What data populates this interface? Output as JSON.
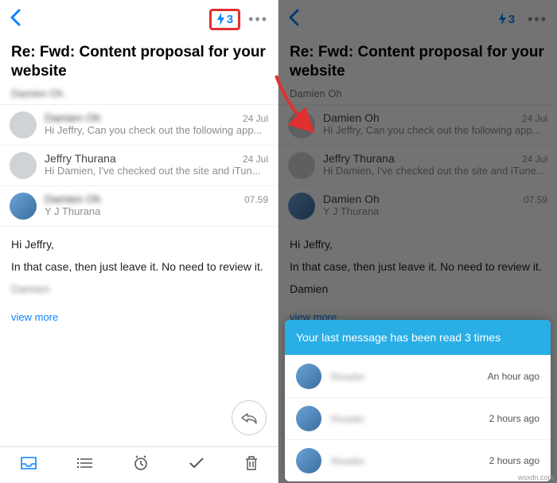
{
  "left": {
    "bolt_count": "3",
    "subject": "Re: Fwd: Content proposal for your website",
    "from": "Damien Oh",
    "messages": [
      {
        "sender": "Damien Oh",
        "senderBlur": true,
        "time": "24 Jul",
        "preview": "Hi Jeffry, Can you check out the following app..."
      },
      {
        "sender": "Jeffry Thurana",
        "senderBlur": false,
        "time": "24 Jul",
        "preview": "Hi Damien, I've checked out the site and iTun..."
      },
      {
        "sender": "Damien Oh",
        "senderBlur": true,
        "time": "07.59",
        "preview": "Y J Thurana"
      }
    ],
    "body1": "Hi Jeffry,",
    "body2": "In that case, then just leave it. No need to review it.",
    "body3": "Damien",
    "view_more": "view more"
  },
  "right": {
    "bolt_count": "3",
    "subject": "Re: Fwd: Content proposal for your website",
    "from": "Damien Oh",
    "messages": [
      {
        "sender": "Damien Oh",
        "time": "24 Jul",
        "preview": "Hi Jeffry, Can you check out the following app..."
      },
      {
        "sender": "Jeffry Thurana",
        "time": "24 Jul",
        "preview": "Hi Damien, I've checked out the site and iTune..."
      },
      {
        "sender": "Damien Oh",
        "time": "07.59",
        "preview": "Y J Thurana"
      }
    ],
    "body1": "Hi Jeffry,",
    "body2": "In that case, then just leave it. No need to review it.",
    "body3": "Damien",
    "view_more": "view more",
    "sheet_title": "Your last message has been read 3 times",
    "reads": [
      {
        "name": "Reader",
        "ago": "An hour ago"
      },
      {
        "name": "Reader",
        "ago": "2 hours ago"
      },
      {
        "name": "Reader",
        "ago": "2 hours ago"
      }
    ]
  },
  "watermark": "wsxdn.com"
}
